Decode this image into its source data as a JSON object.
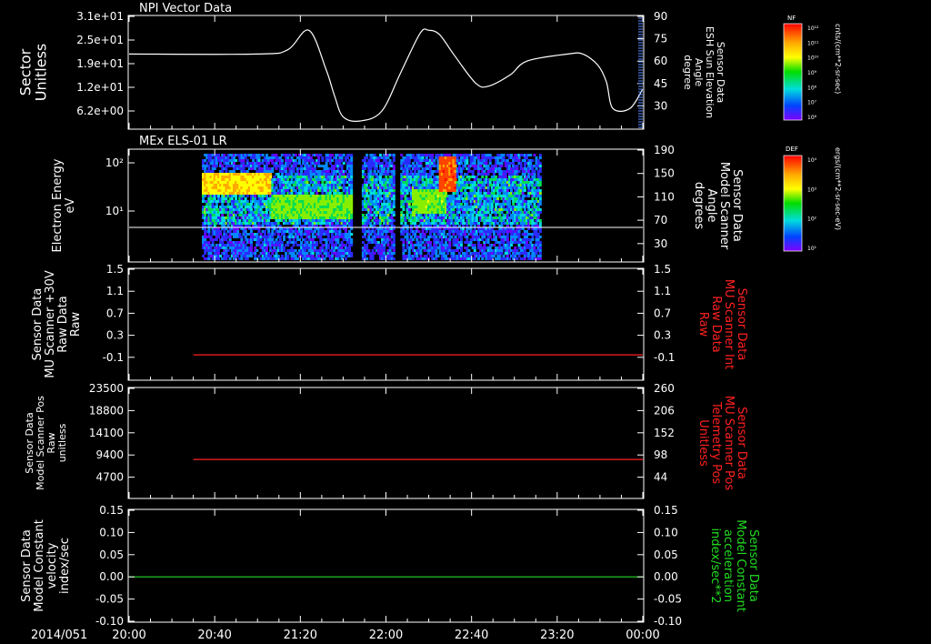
{
  "time_axis": {
    "date_label": "2014/051",
    "ticks": [
      "20:00",
      "20:40",
      "21:20",
      "22:00",
      "22:40",
      "23:20",
      "00:00"
    ],
    "range_minutes": [
      0,
      240
    ]
  },
  "colorbars": [
    {
      "tag": "NF",
      "unit": "cnts/(cm**2-sr-sec)",
      "ticks": [
        "10¹²",
        "10¹¹",
        "10¹⁰",
        "10⁹",
        "10⁸",
        "10⁷",
        "10⁶"
      ]
    },
    {
      "tag": "DEF",
      "unit": "ergs/(cm**2-sr-sec-eV)",
      "ticks": [
        "10⁴",
        "10³",
        "10²",
        "10¹"
      ]
    }
  ],
  "chart_data": [
    {
      "type": "line",
      "title": "NPI Vector Data",
      "ylabel": [
        "Sector",
        "Unitless"
      ],
      "y_ticks": [
        "3.1e+01",
        "2.5e+01",
        "1.9e+01",
        "1.2e+01",
        "6.2e+00"
      ],
      "right_label": [
        "Sensor Data",
        "ESH Sun Elevation",
        "Angle",
        "degree"
      ],
      "right_label_color": "#ffffff",
      "right_ticks": [
        "90",
        "75",
        "60",
        "45",
        "30"
      ],
      "right_range": [
        15,
        90
      ],
      "series": [
        {
          "color": "#ffffff",
          "x": [
            0,
            60,
            74,
            84,
            92,
            96,
            100,
            108,
            118,
            127,
            136,
            140,
            145,
            152,
            162,
            168,
            178,
            186,
            205,
            212,
            219,
            223,
            226,
            234,
            240
          ],
          "y": [
            63,
            63,
            66,
            80,
            52,
            33,
            18,
            15,
            22,
            50,
            78,
            80,
            77,
            62,
            42,
            40,
            48,
            58,
            63,
            63,
            55,
            43,
            24,
            24,
            38
          ]
        }
      ]
    },
    {
      "type": "heatmap",
      "title": "MEx ELS-01 LR",
      "ylabel": [
        "Electron Energy",
        "eV"
      ],
      "y_ticks": [
        "10²",
        "10¹"
      ],
      "y_log_range": [
        1,
        200
      ],
      "right_label": [
        "Sensor Data",
        "Model Scanner",
        "Angle",
        "degrees"
      ],
      "right_label_color": "#ffffff",
      "right_ticks": [
        "190",
        "150",
        "110",
        "70",
        "30"
      ],
      "right_range": [
        0,
        190
      ],
      "data_window_minutes": [
        34,
        192
      ],
      "gap_minutes": [
        [
          104,
          108
        ],
        [
          124,
          126
        ]
      ],
      "bands": [
        {
          "x": [
            34,
            66
          ],
          "energy": [
            25,
            70
          ],
          "level": 0.78
        },
        {
          "x": [
            66,
            104
          ],
          "energy": [
            8,
            25
          ],
          "level": 0.6
        },
        {
          "x": [
            132,
            148
          ],
          "energy": [
            10,
            35
          ],
          "level": 0.62
        },
        {
          "x": [
            144,
            152
          ],
          "energy": [
            30,
            150
          ],
          "level": 0.95
        }
      ],
      "overlay_line": {
        "color": "#ffffff",
        "y": 5
      }
    },
    {
      "type": "line",
      "ylabel": [
        "Sensor Data",
        "MU Scanner +30V",
        "Raw Data",
        "Raw"
      ],
      "y_ticks": [
        "1.5",
        "1.1",
        "0.7",
        "0.3",
        "-0.1"
      ],
      "y_range": [
        -0.3,
        1.5
      ],
      "right_label": [
        "Sensor Data",
        "MU Scanner Int",
        "Raw Data",
        "Raw"
      ],
      "right_label_color": "#ff2020",
      "right_ticks": [
        "1.5",
        "1.1",
        "0.7",
        "0.3",
        "-0.1"
      ],
      "series": [
        {
          "color": "#ff2020",
          "x": [
            30,
            240
          ],
          "y": [
            0.1,
            0.1
          ]
        }
      ]
    },
    {
      "type": "line",
      "ylabel": [
        "Sensor Data",
        "Model Scanner Pos",
        "Raw",
        "unitless"
      ],
      "y_ticks": [
        "23500",
        "18800",
        "14100",
        "9400",
        "4700"
      ],
      "y_range": [
        0,
        23500
      ],
      "right_label": [
        "Sensor Data",
        "MU Scanner Pos",
        "Telemetry Pos",
        "Unitless"
      ],
      "right_label_color": "#ff2020",
      "right_ticks": [
        "260",
        "206",
        "152",
        "98",
        "44"
      ],
      "series": [
        {
          "color": "#ff2020",
          "x": [
            30,
            240
          ],
          "y": [
            8200,
            8200
          ]
        }
      ]
    },
    {
      "type": "line",
      "ylabel": [
        "Sensor Data",
        "Model Constant",
        "velocity",
        "index/sec"
      ],
      "y_ticks": [
        "0.15",
        "0.10",
        "0.05",
        "0.00",
        "-0.05",
        "-0.10"
      ],
      "y_range": [
        -0.1,
        0.15
      ],
      "right_label": [
        "Sensor Data",
        "Model Constant",
        "acceleration",
        "index/sec**2"
      ],
      "right_label_color": "#22dd22",
      "right_ticks": [
        "0.15",
        "0.10",
        "0.05",
        "0.00",
        "-0.05",
        "-0.10"
      ],
      "series": [
        {
          "color": "#22dd22",
          "x": [
            0,
            240
          ],
          "y": [
            0,
            0
          ]
        }
      ]
    }
  ]
}
